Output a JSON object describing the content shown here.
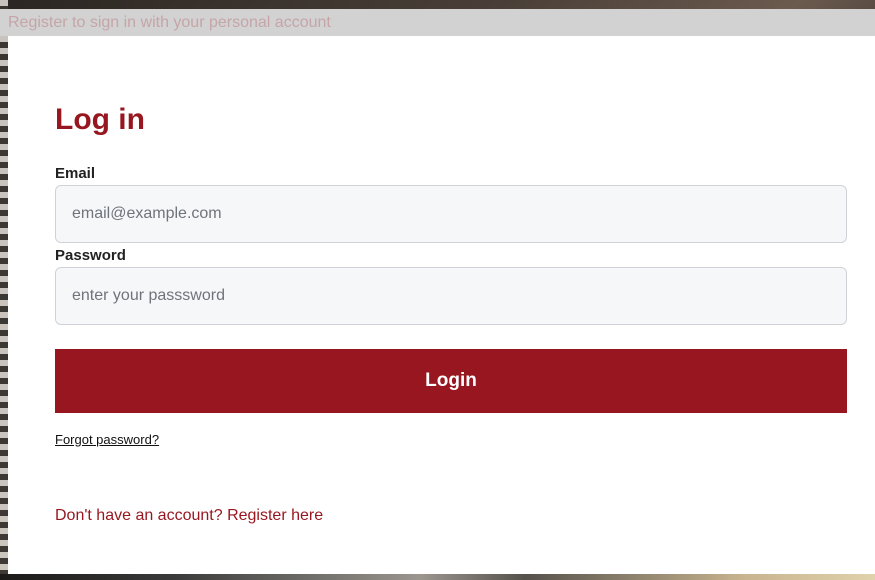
{
  "banner": {
    "text": "Register to sign in with your personal account"
  },
  "login": {
    "title": "Log in",
    "email_label": "Email",
    "email_placeholder": "email@example.com",
    "email_value": "",
    "password_label": "Password",
    "password_placeholder": "enter your passsword",
    "password_value": "",
    "submit_label": "Login",
    "forgot_label": "Forgot password?",
    "register_label": "Don't have an account? Register here"
  },
  "colors": {
    "accent": "#98161f",
    "input_bg": "#f6f7f9",
    "banner_bg": "#d2d2d2"
  }
}
